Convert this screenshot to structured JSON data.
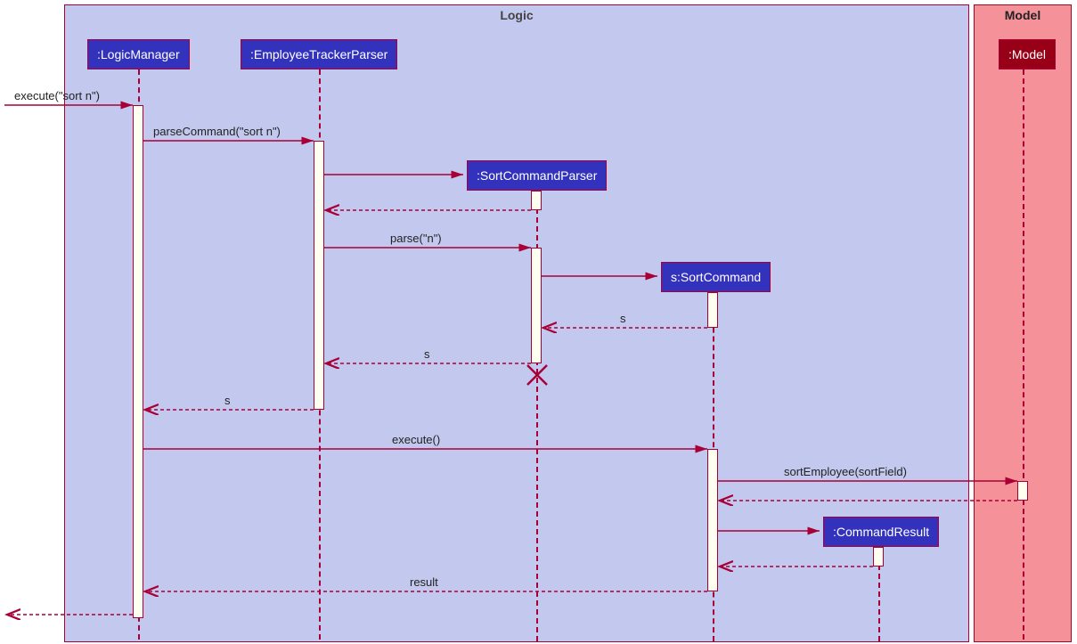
{
  "regions": {
    "logic": {
      "label": "Logic"
    },
    "model": {
      "label": "Model"
    }
  },
  "participants": {
    "logicManager": ":LogicManager",
    "parser": ":EmployeeTrackerParser",
    "sortCmdParser": ":SortCommandParser",
    "sortCmd": "s:SortCommand",
    "cmdResult": ":CommandResult",
    "model": ":Model"
  },
  "messages": {
    "m1": "execute(\"sort n\")",
    "m2": "parseCommand(\"sort n\")",
    "m3": "parse(\"n\")",
    "m4": "s",
    "m5": "s",
    "m6": "s",
    "m7": "execute()",
    "m8": "sortEmployee(sortField)",
    "m9": "result"
  }
}
